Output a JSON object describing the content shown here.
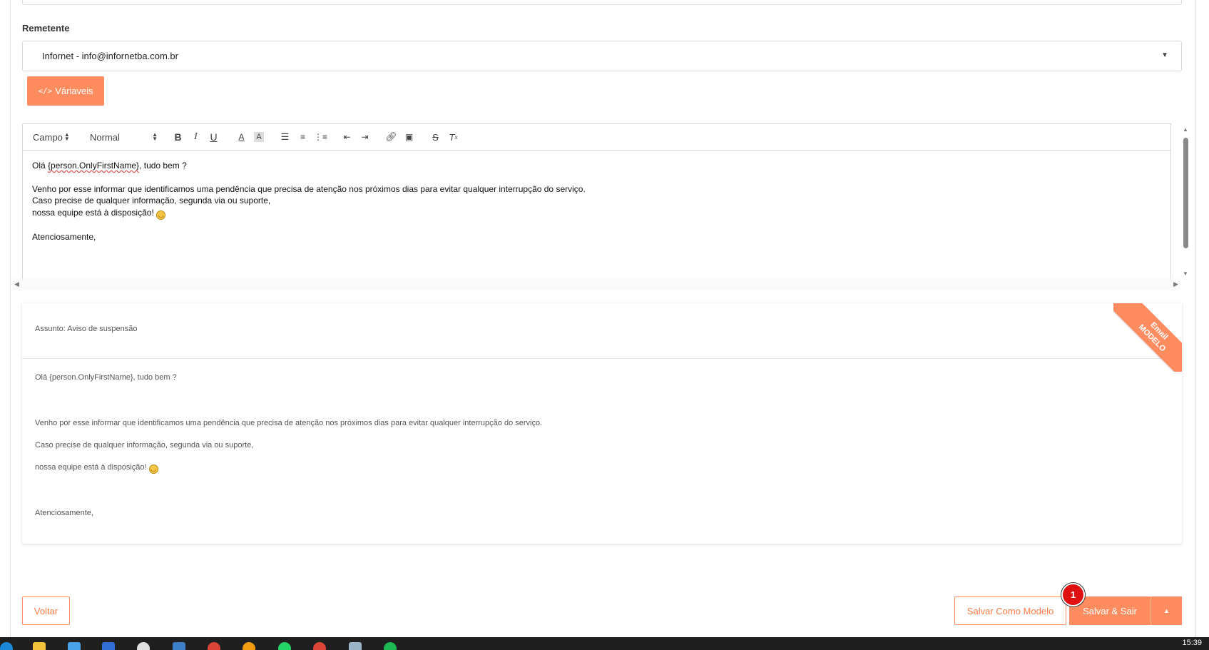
{
  "sender": {
    "label": "Remetente",
    "value": "Infornet - info@infornetba.com.br"
  },
  "variables_button": {
    "icon": "code-icon",
    "label": "Váriaveis"
  },
  "editor": {
    "toolbar": {
      "field_picker": "Campo",
      "style_picker": "Normal"
    },
    "content": {
      "line1_prefix": "Olá ",
      "line1_var": "{person.OnlyFirstName}",
      "line1_suffix": ", tudo bem ?",
      "line2": "Venho por esse informar que identificamos uma pendência que precisa de atenção nos próximos dias para evitar qualquer interrupção do serviço.",
      "line3": "Caso precise de qualquer informação, segunda via ou suporte,",
      "line4": "nossa equipe está à disposição! ",
      "line5": "Atenciosamente,"
    }
  },
  "preview": {
    "subject": "Assunto: Aviso de suspensão",
    "ribbon_line1": "Email",
    "ribbon_line2": "MODELO",
    "line1": "Olá {person.OnlyFirstName}, tudo bem ?",
    "line2": "Venho por esse informar que identificamos uma pendência que precisa de atenção nos próximos dias para evitar qualquer interrupção do serviço.",
    "line3": "Caso precise de qualquer informação, segunda via ou suporte,",
    "line4": "nossa equipe está à disposição! ",
    "line5": "Atenciosamente,"
  },
  "actions": {
    "back": "Voltar",
    "save_model": "Salvar Como Modelo",
    "save_exit": "Salvar & Sair",
    "badge": "1"
  },
  "taskbar": {
    "clock": "15:39"
  },
  "colors": {
    "accent": "#ff8c5f",
    "badge": "#e01010"
  }
}
